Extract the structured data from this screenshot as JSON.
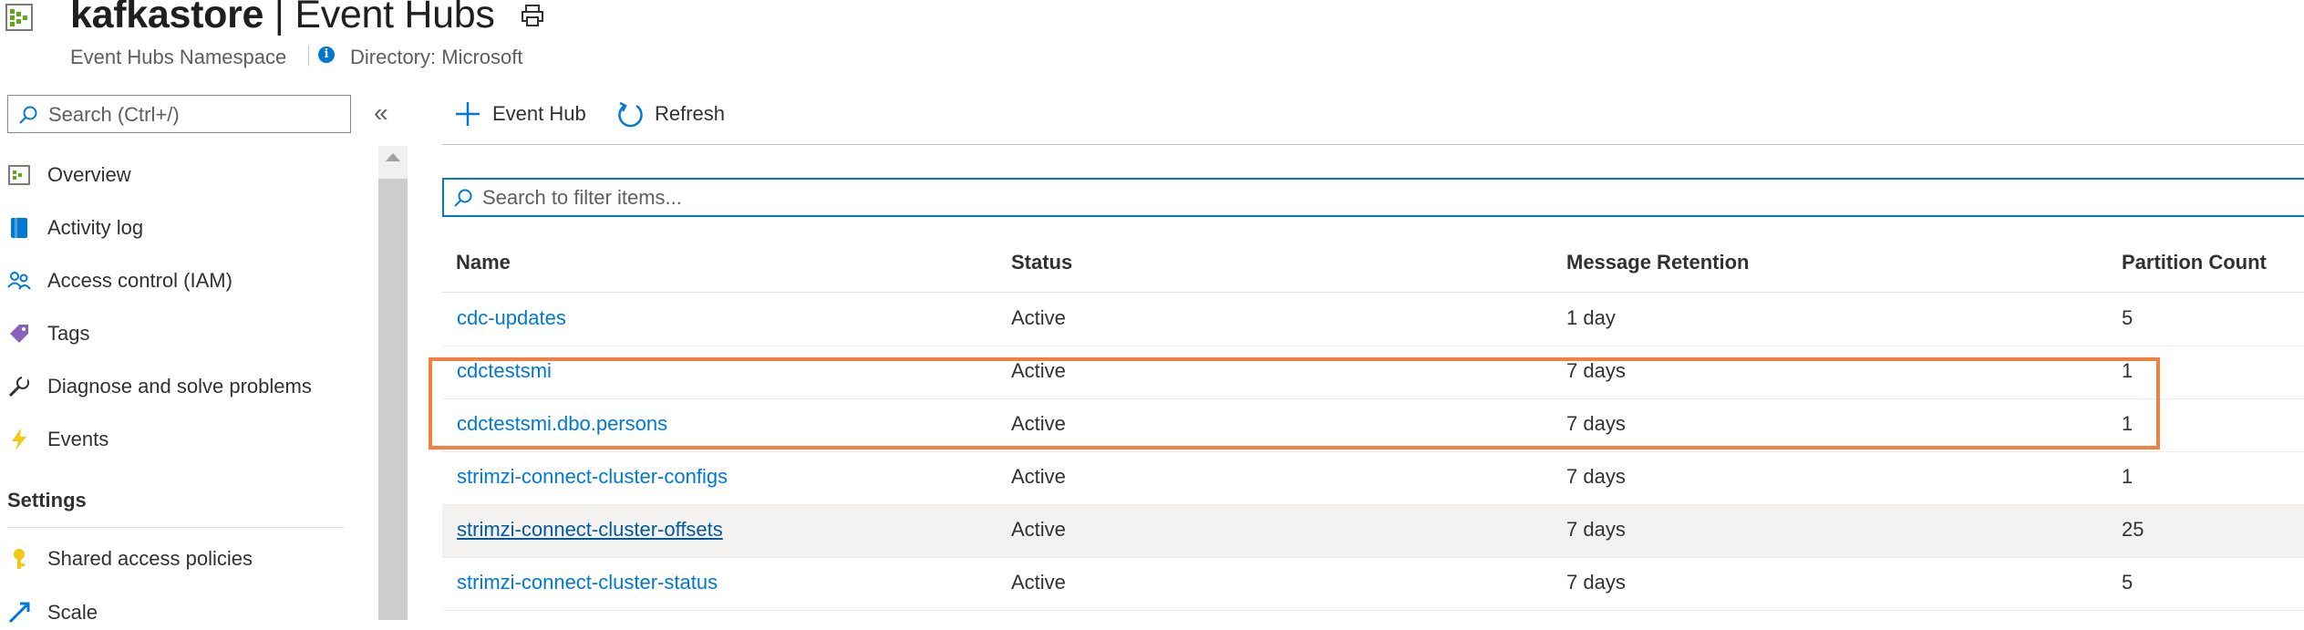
{
  "header": {
    "resource_name": "kafkastore",
    "separator": " | ",
    "page_name": "Event Hubs",
    "subtitle": "Event Hubs Namespace",
    "directory": "Directory: Microsoft"
  },
  "nav": {
    "search_placeholder": "Search (Ctrl+/)",
    "collapse_glyph": "«",
    "items": [
      {
        "label": "Overview",
        "icon": "overview-icon"
      },
      {
        "label": "Activity log",
        "icon": "activity-log-icon"
      },
      {
        "label": "Access control (IAM)",
        "icon": "people-icon"
      },
      {
        "label": "Tags",
        "icon": "tag-icon"
      },
      {
        "label": "Diagnose and solve problems",
        "icon": "wrench-icon"
      },
      {
        "label": "Events",
        "icon": "lightning-icon"
      }
    ],
    "settings_heading": "Settings",
    "settings_items": [
      {
        "label": "Shared access policies",
        "icon": "key-icon"
      },
      {
        "label": "Scale",
        "icon": "scale-icon"
      }
    ]
  },
  "toolbar": {
    "add_label": "Event Hub",
    "refresh_label": "Refresh"
  },
  "filter": {
    "placeholder": "Search to filter items..."
  },
  "table": {
    "columns": [
      "Name",
      "Status",
      "Message Retention",
      "Partition Count"
    ],
    "rows": [
      {
        "name": "cdc-updates",
        "status": "Active",
        "retention": "1 day",
        "partitions": "5"
      },
      {
        "name": "cdctestsmi",
        "status": "Active",
        "retention": "7 days",
        "partitions": "1"
      },
      {
        "name": "cdctestsmi.dbo.persons",
        "status": "Active",
        "retention": "7 days",
        "partitions": "1"
      },
      {
        "name": "strimzi-connect-cluster-configs",
        "status": "Active",
        "retention": "7 days",
        "partitions": "1"
      },
      {
        "name": "strimzi-connect-cluster-offsets",
        "status": "Active",
        "retention": "7 days",
        "partitions": "25"
      },
      {
        "name": "strimzi-connect-cluster-status",
        "status": "Active",
        "retention": "7 days",
        "partitions": "5"
      }
    ]
  },
  "colors": {
    "accent": "#0078d4",
    "highlight": "#f5803e",
    "text": "#323130"
  }
}
